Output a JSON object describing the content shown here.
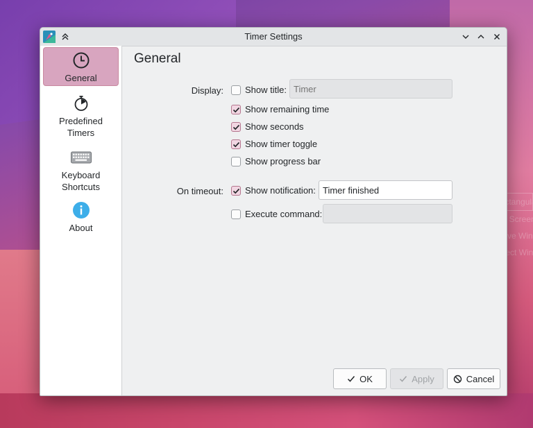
{
  "window": {
    "title": "Timer Settings"
  },
  "sidebar": {
    "items": [
      {
        "label": "General",
        "icon": "clock-icon",
        "active": true
      },
      {
        "label": "Predefined\nTimers",
        "icon": "stopwatch-icon",
        "active": false
      },
      {
        "label": "Keyboard\nShortcuts",
        "icon": "keyboard-icon",
        "active": false
      },
      {
        "label": "About",
        "icon": "info-icon",
        "active": false
      }
    ]
  },
  "page": {
    "heading": "General",
    "display_label": "Display:",
    "show_title": {
      "label": "Show title:",
      "checked": false,
      "input_placeholder": "Timer"
    },
    "show_remaining_time": {
      "label": "Show remaining time",
      "checked": true
    },
    "show_seconds": {
      "label": "Show seconds",
      "checked": true
    },
    "show_timer_toggle": {
      "label": "Show timer toggle",
      "checked": true
    },
    "show_progress_bar": {
      "label": "Show progress bar",
      "checked": false
    },
    "timeout_label": "On timeout:",
    "show_notification": {
      "label": "Show notification:",
      "checked": true,
      "input_value": "Timer finished"
    },
    "execute_command": {
      "label": "Execute command:",
      "checked": false,
      "input_value": ""
    }
  },
  "buttons": {
    "ok": "OK",
    "apply": "Apply",
    "cancel": "Cancel"
  },
  "background_menu": [
    "Rectangular",
    "Full Screen",
    "Active Window",
    "Select Window"
  ],
  "colors": {
    "accent": "#d8a5bf",
    "check_bg": "#f1d6e2",
    "info_blue": "#3daee9"
  }
}
